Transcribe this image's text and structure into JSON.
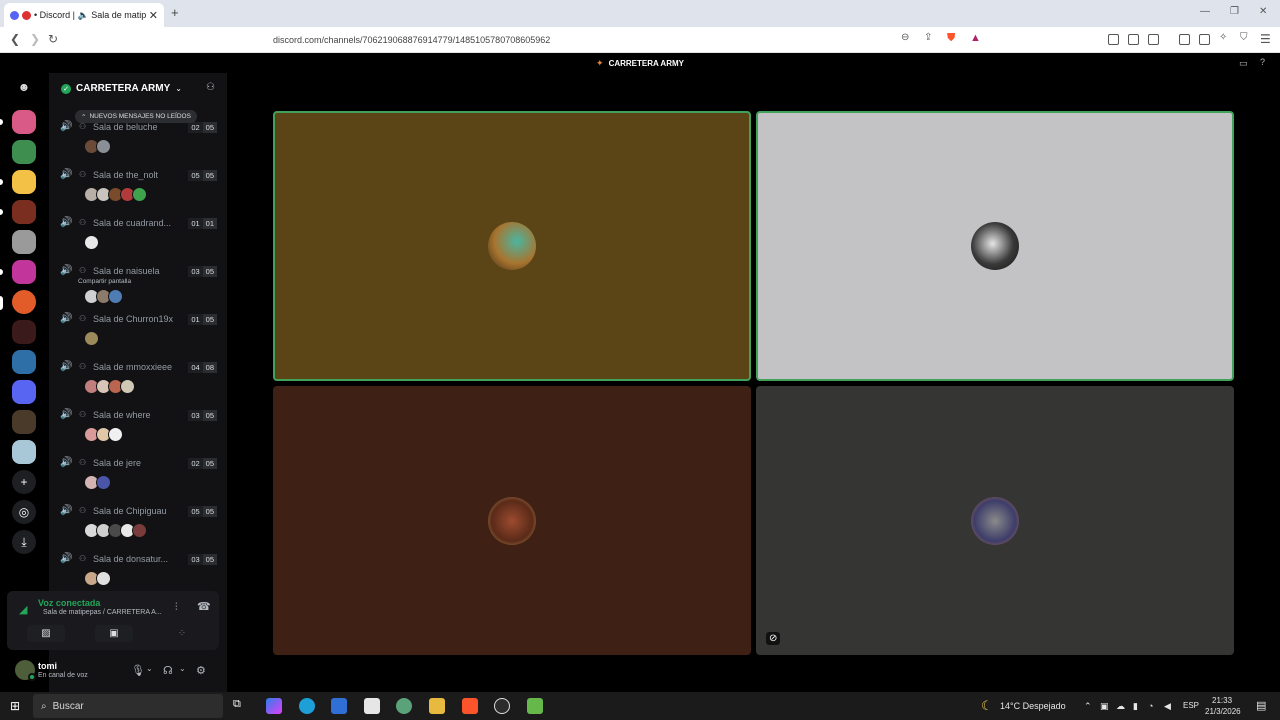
{
  "browser": {
    "tab_title": "• Discord | 🔈 Sala de matipe",
    "tab_close": "✕",
    "new_tab": "+",
    "url": "discord.com/channels/706219068876914779/1485105780708605962"
  },
  "discord": {
    "window_title": "CARRETERA ARMY",
    "server": {
      "name": "CARRETERA ARMY",
      "new_messages": "NUEVOS MENSAJES NO LEÍDOS"
    },
    "voice_channels": [
      {
        "name": "Sala de beluche",
        "count_a": "02",
        "count_b": "05",
        "avatars": [
          "#6b4a3a",
          "#8a8f97"
        ],
        "sharing": ""
      },
      {
        "name": "Sala de the_nolt",
        "count_a": "05",
        "count_b": "05",
        "avatars": [
          "#b8b0a7",
          "#c9c4bd",
          "#7a4b2b",
          "#b13b3b",
          "#3fa34d"
        ],
        "sharing": ""
      },
      {
        "name": "Sala de cuadrand...",
        "count_a": "01",
        "count_b": "01",
        "avatars": [
          "#e8e8e8"
        ],
        "sharing": ""
      },
      {
        "name": "Sala de naisuela",
        "count_a": "03",
        "count_b": "05",
        "avatars": [
          "#d0d0d0",
          "#8c7b6b",
          "#4f7db3"
        ],
        "sharing": "Compartir pantalla"
      },
      {
        "name": "Sala de Churron19x",
        "count_a": "01",
        "count_b": "05",
        "avatars": [
          "#9c8a5a"
        ],
        "sharing": ""
      },
      {
        "name": "Sala de mmoxxieee",
        "count_a": "04",
        "count_b": "08",
        "avatars": [
          "#c27d7d",
          "#d7c6b8",
          "#b9654f",
          "#cfc8b5"
        ],
        "sharing": ""
      },
      {
        "name": "Sala de where",
        "count_a": "03",
        "count_b": "05",
        "avatars": [
          "#d99a9a",
          "#e0c7a8",
          "#f0f0f0"
        ],
        "sharing": ""
      },
      {
        "name": "Sala de jere",
        "count_a": "02",
        "count_b": "05",
        "avatars": [
          "#d4b3b3",
          "#4a55a8"
        ],
        "sharing": ""
      },
      {
        "name": "Sala de Chipiguau",
        "count_a": "05",
        "count_b": "05",
        "avatars": [
          "#d9d9d9",
          "#cfcfcf",
          "#4a4a4a",
          "#e8e8e8",
          "#7a3b3b"
        ],
        "sharing": ""
      },
      {
        "name": "Sala de donsatur...",
        "count_a": "03",
        "count_b": "05",
        "avatars": [
          "#c9a78a",
          "#e0e0e0"
        ],
        "sharing": ""
      }
    ],
    "voice_panel": {
      "status": "Voz conectada",
      "channel": "Sala de matipepas / CARRETERA A..."
    },
    "user": {
      "name": "tomi",
      "status": "En canal de voz"
    }
  },
  "taskbar": {
    "search": "Buscar",
    "weather": "14°C  Despejado",
    "lang": "ESP",
    "time": "21:33",
    "date": "21/3/2026"
  },
  "colors": {
    "tile1": "#5b4516",
    "tile2": "#c3c2c5",
    "tile3": "#3e2114",
    "tile4": "#353533",
    "speaking": "#43a25a"
  }
}
